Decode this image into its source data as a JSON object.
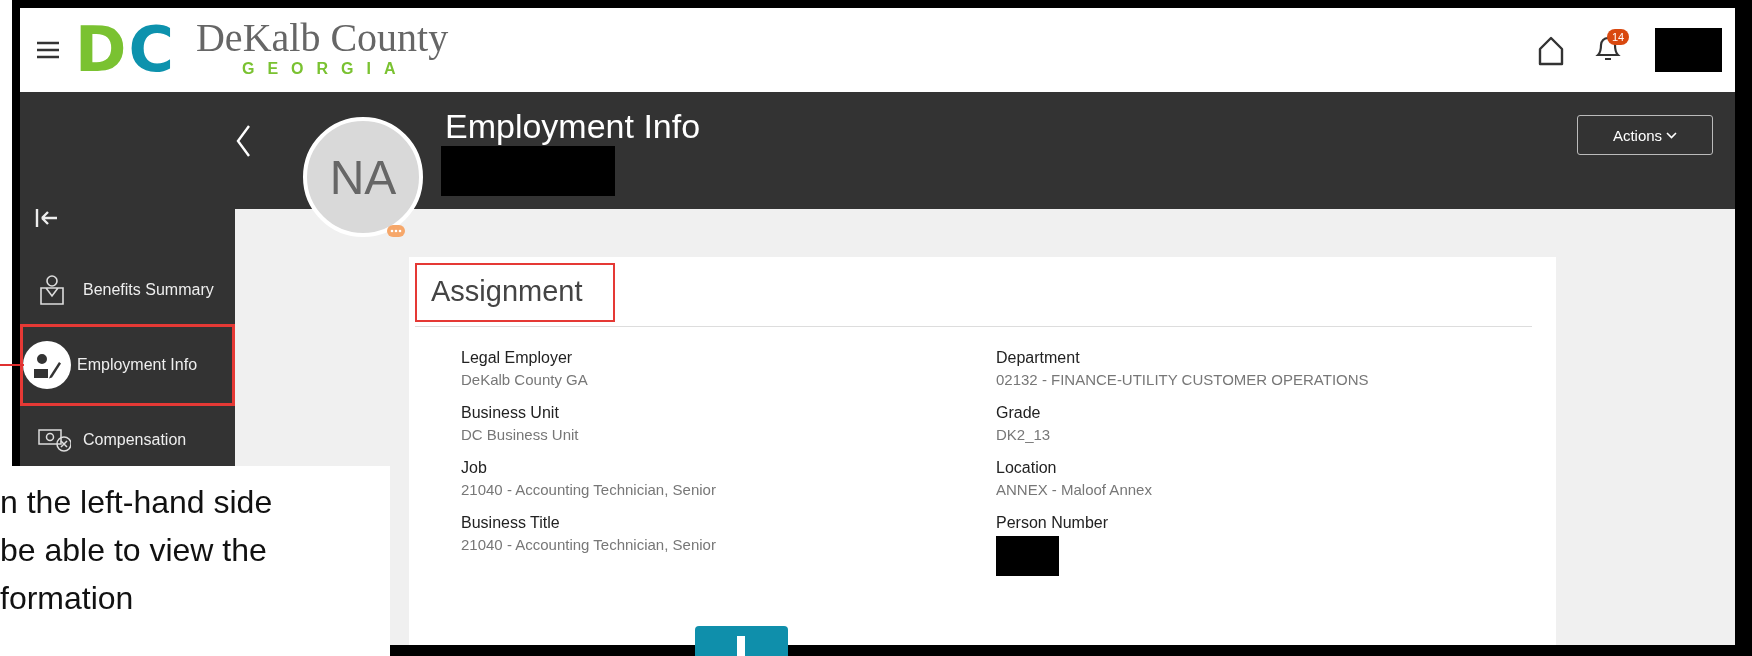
{
  "header": {
    "logo": {
      "monogram": [
        "D",
        "C"
      ],
      "name": "DeKalb County",
      "region": "GEORGIA"
    },
    "notifications_badge": "14",
    "user_redacted": true
  },
  "sidebar": {
    "items": [
      {
        "label": "Benefits Summary",
        "selected": false,
        "highlighted": false
      },
      {
        "label": "Employment Info",
        "selected": true,
        "highlighted": true
      },
      {
        "label": "Compensation",
        "selected": false,
        "highlighted": false
      }
    ]
  },
  "profile": {
    "initials": "NA",
    "title": "Employment Info",
    "name_redacted": true,
    "actions_button": "Actions"
  },
  "assignment": {
    "title": "Assignment",
    "highlighted": true,
    "fields": [
      {
        "label": "Legal Employer",
        "value": "DeKalb County GA"
      },
      {
        "label": "Department",
        "value": "02132 - FINANCE-UTILITY CUSTOMER OPERATIONS"
      },
      {
        "label": "Business Unit",
        "value": "DC Business Unit"
      },
      {
        "label": "Grade",
        "value": "DK2_13"
      },
      {
        "label": "Job",
        "value": "21040 - Accounting Technician, Senior"
      },
      {
        "label": "Location",
        "value": "ANNEX - Maloof Annex"
      },
      {
        "label": "Business Title",
        "value": "21040 - Accounting Technician, Senior"
      },
      {
        "label": "Person Number",
        "redacted": true
      }
    ]
  },
  "callout": {
    "lines": [
      "n the left-hand side",
      "be able to view the",
      "formation"
    ]
  }
}
